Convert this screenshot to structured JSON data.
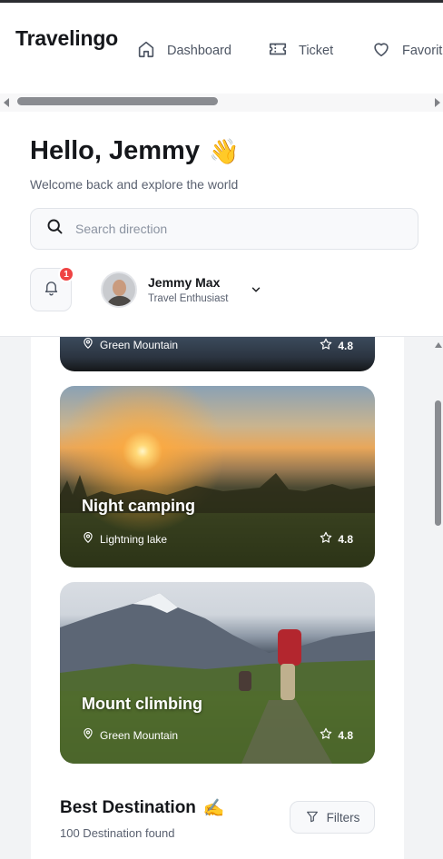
{
  "app": {
    "brand": "Travelingo"
  },
  "nav": [
    {
      "label": "Dashboard",
      "icon": "home-icon"
    },
    {
      "label": "Ticket",
      "icon": "ticket-icon"
    },
    {
      "label": "Favorite",
      "icon": "heart-icon"
    }
  ],
  "header": {
    "greeting": "Hello, Jemmy",
    "greeting_emoji": "👋",
    "subtitle": "Welcome back and explore the world"
  },
  "search": {
    "placeholder": "Search direction",
    "value": ""
  },
  "notifications": {
    "count": "1"
  },
  "user": {
    "name": "Jemmy Max",
    "role": "Travel Enthusiast"
  },
  "cards": [
    {
      "title": "",
      "location": "Green Mountain",
      "rating": "4.8"
    },
    {
      "title": "Night camping",
      "location": "Lightning lake",
      "rating": "4.8"
    },
    {
      "title": "Mount climbing",
      "location": "Green Mountain",
      "rating": "4.8"
    }
  ],
  "best_destination": {
    "title": "Best Destination",
    "emoji": "✍️",
    "count_text": "100 Destination found",
    "filters_label": "Filters"
  },
  "colors": {
    "badge": "#ef4444",
    "text": "#15171b",
    "muted": "#5a6170"
  }
}
